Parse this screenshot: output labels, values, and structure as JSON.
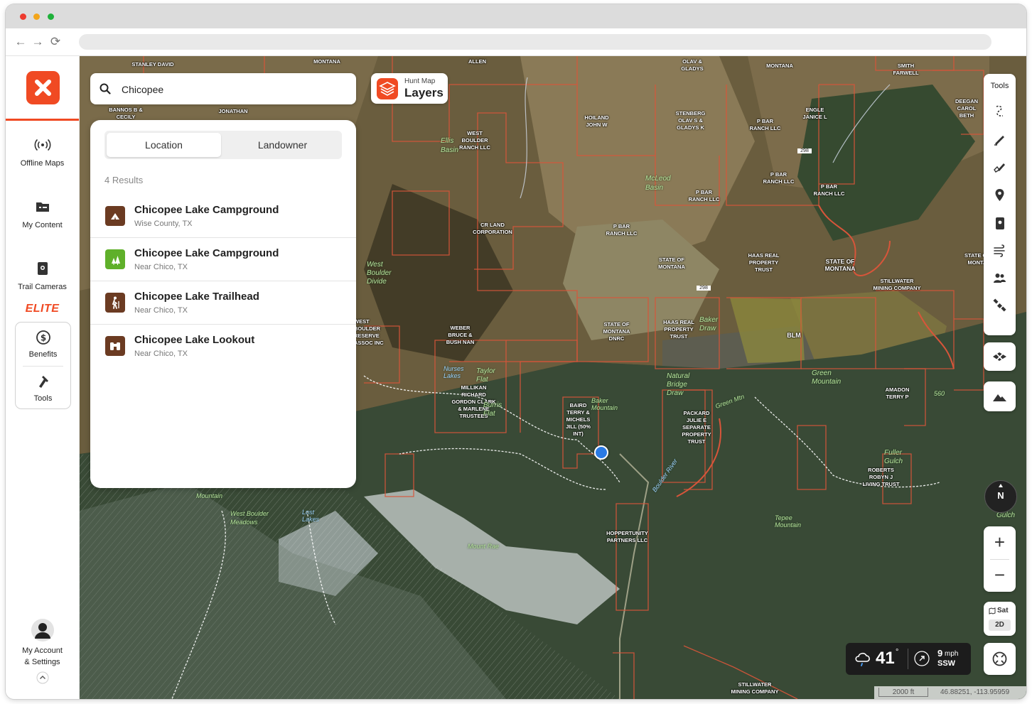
{
  "sidebar": {
    "items": [
      {
        "label": "Offline Maps",
        "icon": "broadcast-icon"
      },
      {
        "label": "My Content",
        "icon": "folder-icon"
      },
      {
        "label": "Trail Cameras",
        "icon": "trail-camera-icon"
      }
    ],
    "elite_label": "ELITE",
    "elite_items": [
      {
        "label": "Benefits",
        "icon": "dollar-circle-icon"
      },
      {
        "label": "Tools",
        "icon": "tools-icon"
      }
    ],
    "account_label_line1": "My Account",
    "account_label_line2": "& Settings"
  },
  "search": {
    "value": "Chicopee"
  },
  "layers_button": {
    "line1": "Hunt Map",
    "line2": "Layers"
  },
  "panel": {
    "tabs": [
      {
        "label": "Location",
        "active": true
      },
      {
        "label": "Landowner",
        "active": false
      }
    ],
    "results_count": "4 Results",
    "results": [
      {
        "title": "Chicopee Lake Campground",
        "subtitle": "Wise County, TX",
        "icon": "campground-icon",
        "color": "#6b3b22"
      },
      {
        "title": "Chicopee Lake Campground",
        "subtitle": "Near Chico, TX",
        "icon": "forest-campground-icon",
        "color": "#5fb02a"
      },
      {
        "title": "Chicopee Lake Trailhead",
        "subtitle": "Near Chico, TX",
        "icon": "hiker-icon",
        "color": "#6b3b22"
      },
      {
        "title": "Chicopee Lake Lookout",
        "subtitle": "Near Chico, TX",
        "icon": "binoculars-icon",
        "color": "#6b3b22"
      }
    ]
  },
  "tools": {
    "title": "Tools"
  },
  "compass": {
    "label": "N"
  },
  "zoom": {
    "in": "+",
    "out": "−"
  },
  "map_type": {
    "mode": "Sat",
    "view": "2D"
  },
  "weather": {
    "temp": "41",
    "degree": "°",
    "wind_speed": "9",
    "wind_unit": "mph",
    "wind_dir": "SSW"
  },
  "scale": {
    "distance": "2000 ft",
    "coords": "46.88251, -113.95959"
  },
  "map_labels": [
    {
      "text": "STANLEY DAVID"
    },
    {
      "text": "MONTANA"
    },
    {
      "text": "ALLEN"
    },
    {
      "text": "OLAV & GLADYS"
    },
    {
      "text": "MONTANA"
    },
    {
      "text": "SMITH FARWELL"
    },
    {
      "text": "DEEGAN CAROL BETH"
    },
    {
      "text": "BANNOS B & CECILY"
    },
    {
      "text": "JONATHAN"
    },
    {
      "text": "HOILAND JOHN W"
    },
    {
      "text": "STENBERG OLAV S & GLADYS K"
    },
    {
      "text": "P BAR RANCH LLC"
    },
    {
      "text": "ENGLE JANICE L"
    },
    {
      "text": "WEST BOULDER RANCH LLC"
    },
    {
      "text": "P BAR RANCH LLC"
    },
    {
      "text": "P BAR RANCH LLC"
    },
    {
      "text": "P BAR RANCH LLC"
    },
    {
      "text": "CR LAND CORPORATION"
    },
    {
      "text": "P BAR RANCH LLC"
    },
    {
      "text": "STATE OF MONTANA"
    },
    {
      "text": "HAAS REAL PROPERTY TRUST"
    },
    {
      "text": "STATE OF MONTANA"
    },
    {
      "text": "STATE OF MONTA"
    },
    {
      "text": "STILLWATER MINING COMPANY"
    },
    {
      "text": "WEST BOULDER RESERVE ASSOC INC"
    },
    {
      "text": "WEBER BRUCE & BUSH NAN"
    },
    {
      "text": "STATE OF MONTANA DNRC"
    },
    {
      "text": "HAAS REAL PROPERTY TRUST"
    },
    {
      "text": "BLM"
    },
    {
      "text": "MILLIKAN RICHARD GORDON CLARK & MARLENE TRUSTEES"
    },
    {
      "text": "BAIRD TERRY & MICHELS JILL (50% INT)"
    },
    {
      "text": "PACKARD JULIE E SEPARATE PROPERTY TRUST"
    },
    {
      "text": "AMADON TERRY P"
    },
    {
      "text": "ROBERTS ROBYN J LIVING TRUST"
    },
    {
      "text": "HOPPERTUNITY PARTNERS LLC"
    },
    {
      "text": "STILLWATER MINING COMPANY"
    }
  ],
  "geo_labels": [
    {
      "text": "Ellis Basin"
    },
    {
      "text": "McLeod Basin"
    },
    {
      "text": "West Boulder Divide"
    },
    {
      "text": "Nurses Lakes"
    },
    {
      "text": "Taylor Flat"
    },
    {
      "text": "Burris Flat"
    },
    {
      "text": "Baker Mountain"
    },
    {
      "text": "Baker Draw"
    },
    {
      "text": "Natural Bridge Draw"
    },
    {
      "text": "Green Mountain"
    },
    {
      "text": "Green Mtn"
    },
    {
      "text": "Boulder River"
    },
    {
      "text": "Fuller Gulch"
    },
    {
      "text": "Tepee Mountain"
    },
    {
      "text": "Mount Rae"
    },
    {
      "text": "West Boulder Meadows"
    },
    {
      "text": "Lost Lakes"
    },
    {
      "text": "Mountain"
    },
    {
      "text": "560"
    },
    {
      "text": "298"
    },
    {
      "text": "298"
    },
    {
      "text": "Gulch"
    }
  ]
}
